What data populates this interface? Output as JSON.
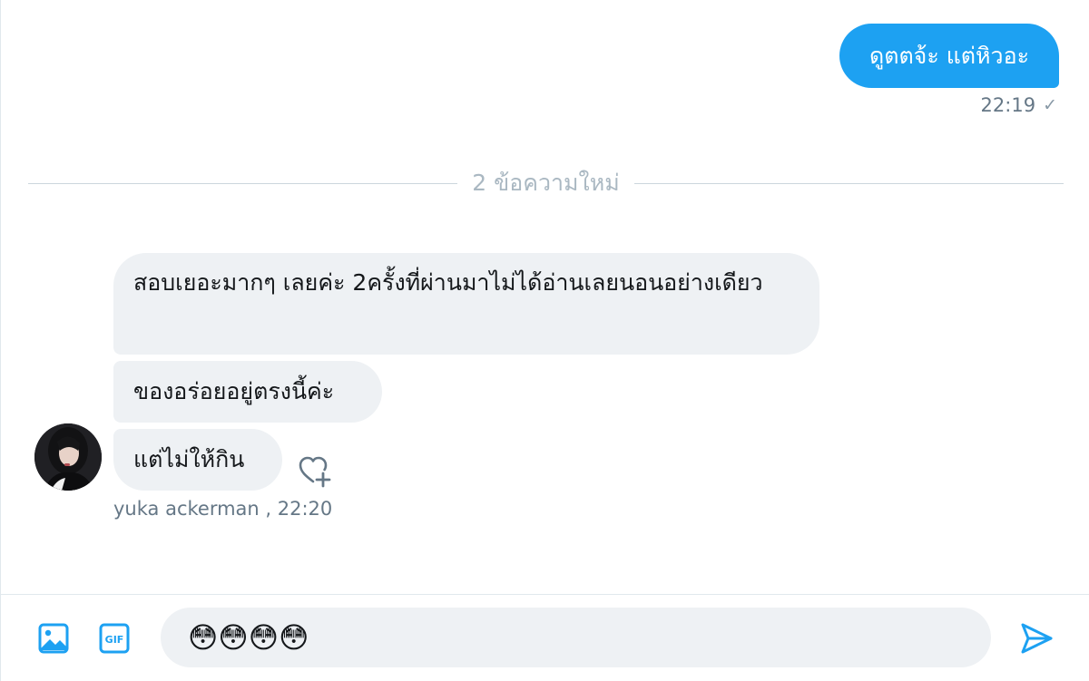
{
  "outgoing": {
    "text": "ดูตตจ้ะ แต่หิวอะ",
    "time": "22:19",
    "status_icon": "check-icon"
  },
  "divider": {
    "text": "2 ข้อความใหม่"
  },
  "incoming": {
    "messages": [
      "สอบเยอะมากๆ เลยค่ะ 2ครั้งที่ผ่านมาไม่ได้อ่านเลยนอนอย่างเดียว",
      "ของอร่อยอยู่ตรงนี้ค่ะ",
      "แต่ไม่ให้กิน"
    ],
    "sender": "yuka ackerman",
    "time_suffix": " , 22:20"
  },
  "composer": {
    "value": "😳😳😳😳",
    "icons": [
      "media-icon",
      "gif-icon",
      "send-icon"
    ]
  },
  "colors": {
    "accent": "#1da1f2",
    "bubble_in": "#eef1f4",
    "meta_text": "#657786"
  }
}
